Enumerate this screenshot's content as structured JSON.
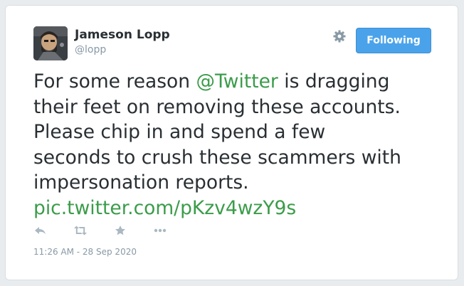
{
  "author": {
    "name": "Jameson Lopp",
    "handle": "@lopp"
  },
  "follow_button": {
    "label": "Following"
  },
  "tweet": {
    "line1_before": "For some reason ",
    "mention": "@Twitter",
    "line1_after": " is dragging",
    "line2": "their feet on removing these accounts.",
    "line3": "Please chip in and spend a few",
    "line4": "seconds to crush these scammers with",
    "line5": "impersonation reports.",
    "link": "pic.twitter.com/pKzv4wzY9s"
  },
  "actions": {
    "icons": [
      "reply-icon",
      "retweet-icon",
      "like-icon",
      "more-icon"
    ]
  },
  "timestamp": "11:26 AM - 28 Sep 2020",
  "colors": {
    "link": "#3b9c4a",
    "button": "#4aa3ea",
    "text": "#292f33",
    "muted": "#8899a6"
  }
}
